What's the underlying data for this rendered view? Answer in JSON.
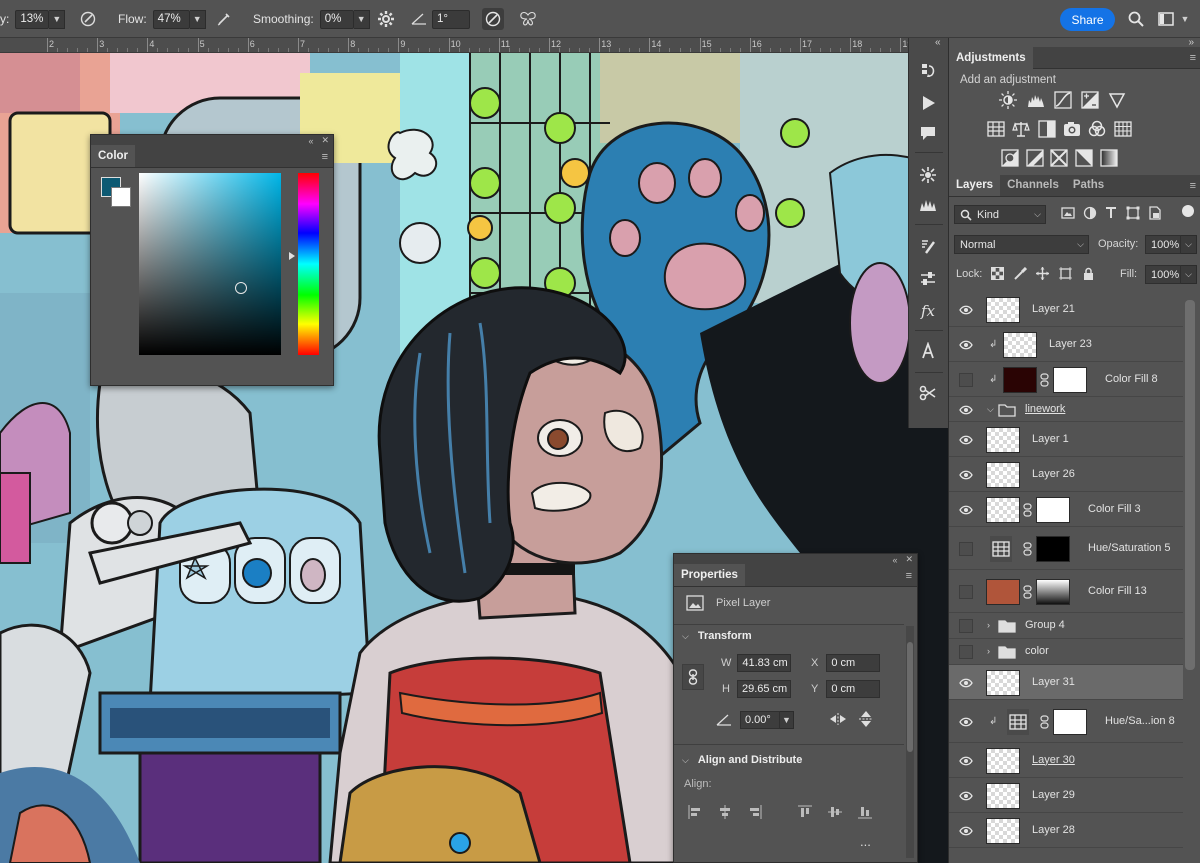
{
  "options_bar": {
    "opacity_partial_label": "y:",
    "opacity_value": "13%",
    "flow_label": "Flow:",
    "flow_value": "47%",
    "smoothing_label": "Smoothing:",
    "smoothing_value": "0%",
    "angle_value": "1°",
    "share_label": "Share"
  },
  "ruler": {
    "labels": [
      "2",
      "3",
      "4",
      "5",
      "6",
      "7",
      "8",
      "9",
      "10",
      "11",
      "12",
      "13",
      "14",
      "15",
      "16",
      "17",
      "18",
      "19"
    ]
  },
  "color_panel": {
    "title": "Color",
    "foreground_color": "#0d5a73",
    "background_color": "#ffffff"
  },
  "properties_panel": {
    "title": "Properties",
    "layer_kind": "Pixel Layer",
    "transform_section": "Transform",
    "w_label": "W",
    "w_value": "41.83 cm",
    "h_label": "H",
    "h_value": "29.65 cm",
    "x_label": "X",
    "x_value": "0 cm",
    "y_label": "Y",
    "y_value": "0 cm",
    "angle_value": "0.00°",
    "align_section": "Align and Distribute",
    "align_label": "Align:",
    "more": "..."
  },
  "adjustments": {
    "title": "Adjustments",
    "subtitle": "Add an adjustment",
    "icons": [
      "brightness-contrast-icon",
      "levels-icon",
      "curves-icon",
      "exposure-icon",
      "vibrance-icon",
      "hue-saturation-icon",
      "color-balance-icon",
      "black-white-icon",
      "photo-filter-icon",
      "channel-mixer-icon",
      "color-lookup-icon",
      "invert-icon",
      "posterize-icon",
      "threshold-icon",
      "selective-color-icon",
      "gradient-map-icon"
    ]
  },
  "layers_panel": {
    "tabs": [
      "Layers",
      "Channels",
      "Paths"
    ],
    "filter_kind": "Kind",
    "blend_mode": "Normal",
    "opacity_label": "Opacity:",
    "opacity_value": "100%",
    "lock_label": "Lock:",
    "fill_label": "Fill:",
    "fill_value": "100%",
    "layers": [
      {
        "name": "Layer 21",
        "visible": true,
        "type": "pixel"
      },
      {
        "name": "Layer 23",
        "visible": true,
        "type": "pixel",
        "clipped": true
      },
      {
        "name": "Color Fill 8",
        "visible": false,
        "type": "fill",
        "clipped": true,
        "swatch": "#2a0404"
      },
      {
        "name": "linework",
        "visible": true,
        "type": "group",
        "expanded": true
      },
      {
        "name": "Layer 1",
        "visible": true,
        "type": "pixel"
      },
      {
        "name": "Layer 26",
        "visible": true,
        "type": "pixel"
      },
      {
        "name": "Color Fill 3",
        "visible": true,
        "type": "fill-mask"
      },
      {
        "name": "Hue/Saturation 5",
        "visible": false,
        "type": "adjustment"
      },
      {
        "name": "Color Fill 13",
        "visible": false,
        "type": "fill",
        "swatch": "#b0553a"
      },
      {
        "name": "Group 4",
        "visible": false,
        "type": "group",
        "expanded": false
      },
      {
        "name": "color",
        "visible": false,
        "type": "group",
        "expanded": false
      },
      {
        "name": "Layer 31",
        "visible": true,
        "type": "pixel",
        "selected": true
      },
      {
        "name": "Hue/Sa...ion 8",
        "visible": true,
        "type": "adjustment",
        "clipped": true
      },
      {
        "name": "Layer 30",
        "visible": true,
        "type": "pixel"
      },
      {
        "name": "Layer 29",
        "visible": true,
        "type": "pixel"
      },
      {
        "name": "Layer 28",
        "visible": true,
        "type": "pixel"
      }
    ]
  }
}
